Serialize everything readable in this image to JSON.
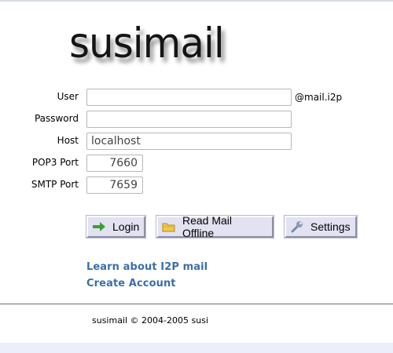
{
  "app": {
    "logo_text": "susimail"
  },
  "form": {
    "user": {
      "label": "User",
      "value": "",
      "suffix": "@mail.i2p"
    },
    "password": {
      "label": "Password",
      "value": ""
    },
    "host": {
      "label": "Host",
      "value": "localhost"
    },
    "pop3_port": {
      "label": "POP3 Port",
      "value": "7660"
    },
    "smtp_port": {
      "label": "SMTP Port",
      "value": "7659"
    }
  },
  "buttons": {
    "login": {
      "label": "Login",
      "icon": "right-arrow-icon"
    },
    "offline": {
      "label": "Read Mail Offline",
      "icon": "folder-icon"
    },
    "settings": {
      "label": "Settings",
      "icon": "wrench-icon"
    }
  },
  "links": {
    "learn": "Learn about I2P mail",
    "create": "Create Account"
  },
  "footer": {
    "text": "susimail © 2004-2005 susi"
  },
  "colors": {
    "button_bg": "#e2e2f2",
    "link": "#3a6fa8",
    "band": "#eceefb"
  }
}
